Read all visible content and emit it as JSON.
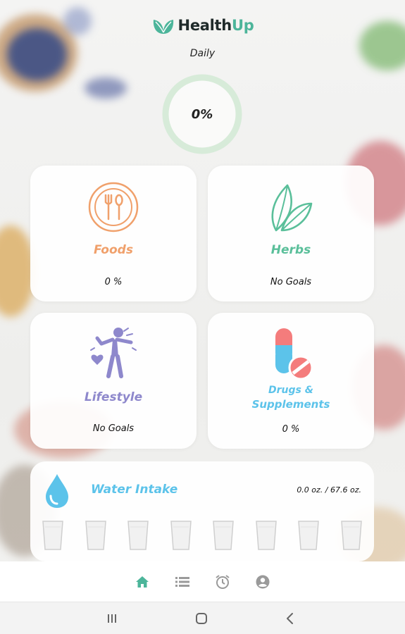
{
  "app": {
    "name_part1": "Health",
    "name_part2": "Up"
  },
  "daily": {
    "label": "Daily",
    "progress_text": "0%",
    "progress_value": 0
  },
  "cards": {
    "foods": {
      "title": "Foods",
      "value": "0 %",
      "color": "#f0a06b"
    },
    "herbs": {
      "title": "Herbs",
      "value": "No Goals",
      "color": "#5abf9a"
    },
    "lifestyle": {
      "title": "Lifestyle",
      "value": "No Goals",
      "color": "#8e88cc"
    },
    "drugs": {
      "title_line1": "Drugs &",
      "title_line2": "Supplements",
      "value": "0 %",
      "color": "#5cc3ea"
    }
  },
  "water": {
    "title": "Water Intake",
    "amount": "0.0 oz. / 67.6 oz.",
    "glass_count": 8,
    "color": "#5cc3ea"
  },
  "bottom_nav": {
    "items": [
      "home-icon",
      "list-icon",
      "alarm-clock-icon",
      "account-icon"
    ],
    "active": "home-icon",
    "active_color": "#4cb59a"
  },
  "system_nav": {
    "items": [
      "recents-icon",
      "home-square-icon",
      "back-icon"
    ]
  }
}
